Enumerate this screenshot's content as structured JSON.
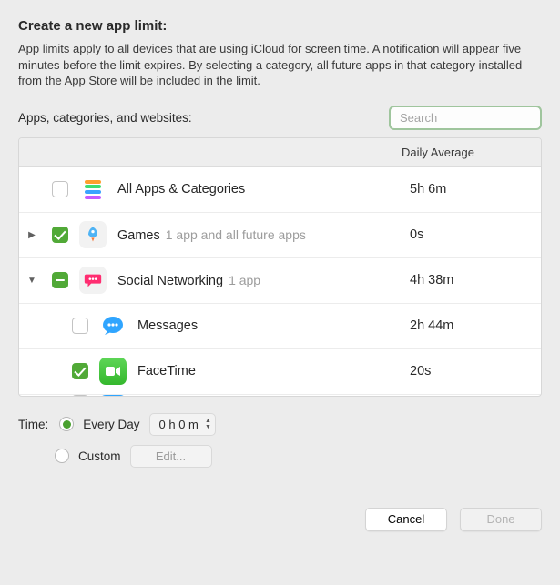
{
  "title": "Create a new app limit:",
  "description": "App limits apply to all devices that are using iCloud for screen time. A notification will appear five minutes before the limit expires. By selecting a category, all future apps in that category installed from the App Store will be included in the limit.",
  "filter_label": "Apps, categories, and websites:",
  "search": {
    "placeholder": "Search"
  },
  "list": {
    "header_avg": "Daily Average",
    "items": [
      {
        "name": "All Apps & Categories",
        "detail": "",
        "avg": "5h 6m"
      },
      {
        "name": "Games",
        "detail": "1 app and all future apps",
        "avg": "0s"
      },
      {
        "name": "Social Networking",
        "detail": "1 app",
        "avg": "4h 38m"
      },
      {
        "name": "Messages",
        "detail": "",
        "avg": "2h 44m"
      },
      {
        "name": "FaceTime",
        "detail": "",
        "avg": "20s"
      }
    ]
  },
  "time": {
    "label": "Time:",
    "every_day_label": "Every Day",
    "custom_label": "Custom",
    "stepper_value": "0 h   0 m",
    "edit_label": "Edit..."
  },
  "buttons": {
    "cancel": "Cancel",
    "done": "Done"
  }
}
